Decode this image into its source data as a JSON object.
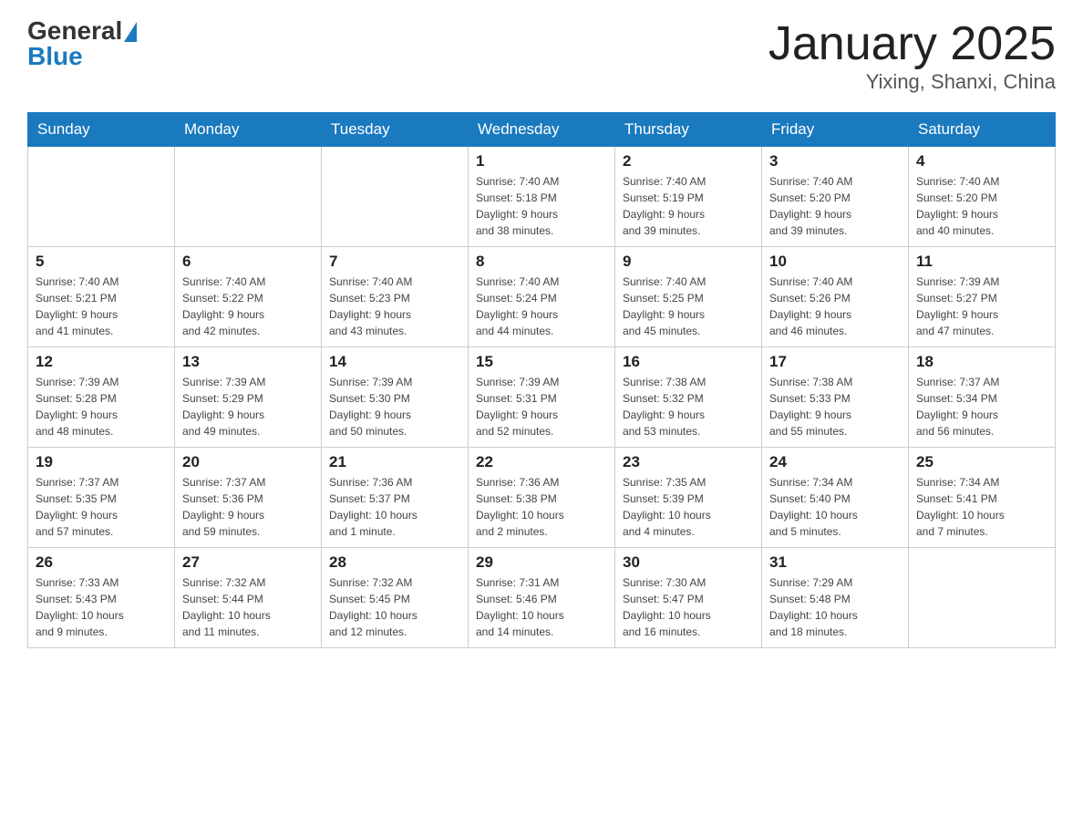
{
  "header": {
    "logo_general": "General",
    "logo_blue": "Blue",
    "month": "January 2025",
    "location": "Yixing, Shanxi, China"
  },
  "days_of_week": [
    "Sunday",
    "Monday",
    "Tuesday",
    "Wednesday",
    "Thursday",
    "Friday",
    "Saturday"
  ],
  "weeks": [
    [
      {
        "day": "",
        "info": ""
      },
      {
        "day": "",
        "info": ""
      },
      {
        "day": "",
        "info": ""
      },
      {
        "day": "1",
        "info": "Sunrise: 7:40 AM\nSunset: 5:18 PM\nDaylight: 9 hours\nand 38 minutes."
      },
      {
        "day": "2",
        "info": "Sunrise: 7:40 AM\nSunset: 5:19 PM\nDaylight: 9 hours\nand 39 minutes."
      },
      {
        "day": "3",
        "info": "Sunrise: 7:40 AM\nSunset: 5:20 PM\nDaylight: 9 hours\nand 39 minutes."
      },
      {
        "day": "4",
        "info": "Sunrise: 7:40 AM\nSunset: 5:20 PM\nDaylight: 9 hours\nand 40 minutes."
      }
    ],
    [
      {
        "day": "5",
        "info": "Sunrise: 7:40 AM\nSunset: 5:21 PM\nDaylight: 9 hours\nand 41 minutes."
      },
      {
        "day": "6",
        "info": "Sunrise: 7:40 AM\nSunset: 5:22 PM\nDaylight: 9 hours\nand 42 minutes."
      },
      {
        "day": "7",
        "info": "Sunrise: 7:40 AM\nSunset: 5:23 PM\nDaylight: 9 hours\nand 43 minutes."
      },
      {
        "day": "8",
        "info": "Sunrise: 7:40 AM\nSunset: 5:24 PM\nDaylight: 9 hours\nand 44 minutes."
      },
      {
        "day": "9",
        "info": "Sunrise: 7:40 AM\nSunset: 5:25 PM\nDaylight: 9 hours\nand 45 minutes."
      },
      {
        "day": "10",
        "info": "Sunrise: 7:40 AM\nSunset: 5:26 PM\nDaylight: 9 hours\nand 46 minutes."
      },
      {
        "day": "11",
        "info": "Sunrise: 7:39 AM\nSunset: 5:27 PM\nDaylight: 9 hours\nand 47 minutes."
      }
    ],
    [
      {
        "day": "12",
        "info": "Sunrise: 7:39 AM\nSunset: 5:28 PM\nDaylight: 9 hours\nand 48 minutes."
      },
      {
        "day": "13",
        "info": "Sunrise: 7:39 AM\nSunset: 5:29 PM\nDaylight: 9 hours\nand 49 minutes."
      },
      {
        "day": "14",
        "info": "Sunrise: 7:39 AM\nSunset: 5:30 PM\nDaylight: 9 hours\nand 50 minutes."
      },
      {
        "day": "15",
        "info": "Sunrise: 7:39 AM\nSunset: 5:31 PM\nDaylight: 9 hours\nand 52 minutes."
      },
      {
        "day": "16",
        "info": "Sunrise: 7:38 AM\nSunset: 5:32 PM\nDaylight: 9 hours\nand 53 minutes."
      },
      {
        "day": "17",
        "info": "Sunrise: 7:38 AM\nSunset: 5:33 PM\nDaylight: 9 hours\nand 55 minutes."
      },
      {
        "day": "18",
        "info": "Sunrise: 7:37 AM\nSunset: 5:34 PM\nDaylight: 9 hours\nand 56 minutes."
      }
    ],
    [
      {
        "day": "19",
        "info": "Sunrise: 7:37 AM\nSunset: 5:35 PM\nDaylight: 9 hours\nand 57 minutes."
      },
      {
        "day": "20",
        "info": "Sunrise: 7:37 AM\nSunset: 5:36 PM\nDaylight: 9 hours\nand 59 minutes."
      },
      {
        "day": "21",
        "info": "Sunrise: 7:36 AM\nSunset: 5:37 PM\nDaylight: 10 hours\nand 1 minute."
      },
      {
        "day": "22",
        "info": "Sunrise: 7:36 AM\nSunset: 5:38 PM\nDaylight: 10 hours\nand 2 minutes."
      },
      {
        "day": "23",
        "info": "Sunrise: 7:35 AM\nSunset: 5:39 PM\nDaylight: 10 hours\nand 4 minutes."
      },
      {
        "day": "24",
        "info": "Sunrise: 7:34 AM\nSunset: 5:40 PM\nDaylight: 10 hours\nand 5 minutes."
      },
      {
        "day": "25",
        "info": "Sunrise: 7:34 AM\nSunset: 5:41 PM\nDaylight: 10 hours\nand 7 minutes."
      }
    ],
    [
      {
        "day": "26",
        "info": "Sunrise: 7:33 AM\nSunset: 5:43 PM\nDaylight: 10 hours\nand 9 minutes."
      },
      {
        "day": "27",
        "info": "Sunrise: 7:32 AM\nSunset: 5:44 PM\nDaylight: 10 hours\nand 11 minutes."
      },
      {
        "day": "28",
        "info": "Sunrise: 7:32 AM\nSunset: 5:45 PM\nDaylight: 10 hours\nand 12 minutes."
      },
      {
        "day": "29",
        "info": "Sunrise: 7:31 AM\nSunset: 5:46 PM\nDaylight: 10 hours\nand 14 minutes."
      },
      {
        "day": "30",
        "info": "Sunrise: 7:30 AM\nSunset: 5:47 PM\nDaylight: 10 hours\nand 16 minutes."
      },
      {
        "day": "31",
        "info": "Sunrise: 7:29 AM\nSunset: 5:48 PM\nDaylight: 10 hours\nand 18 minutes."
      },
      {
        "day": "",
        "info": ""
      }
    ]
  ]
}
